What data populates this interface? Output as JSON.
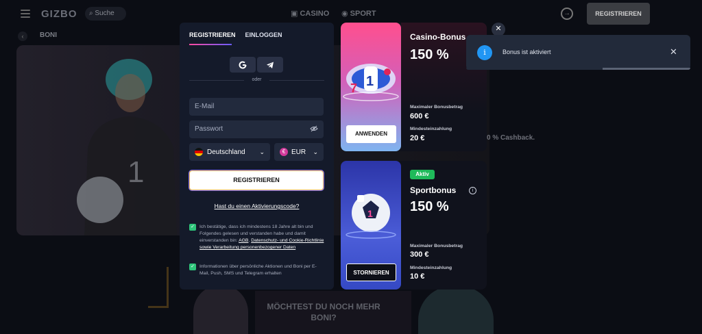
{
  "header": {
    "logo": "GIZBO",
    "search_placeholder": "Suche",
    "nav_casino": "CASINO",
    "nav_sport": "SPORT",
    "register_button": "REGISTRIEREN"
  },
  "breadcrumb": {
    "label": "BONI"
  },
  "background": {
    "cashback_text": "0 % Cashback.",
    "bottom_text": "MÖCHTEST DU NOCH MEHR BONI?"
  },
  "register_panel": {
    "tabs": [
      {
        "label": "REGISTRIEREN",
        "active": true
      },
      {
        "label": "EINLOGGEN",
        "active": false
      }
    ],
    "divider_text": "oder",
    "email_placeholder": "E-Mail",
    "password_placeholder": "Passwort",
    "country": "Deutschland",
    "currency": "EUR",
    "submit_label": "REGISTRIEREN",
    "activation_code_link": "Hast du einen Aktivierungscode?",
    "terms_text": "Ich bestätige, dass ich mindestens 18 Jahre alt bin und Folgendes gelesen und verstanden habe und damit einverstanden bin:",
    "terms_link_agb": "AGB",
    "terms_link_privacy": "Datenschutz- und Cookie-Richtlinie sowie Verarbeitung personenbezogener Daten",
    "newsletter_text": "Informationen über persönliche Aktionen und Boni per E-Mail, Push, SMS und Telegram erhalten",
    "terms_checked": true,
    "newsletter_checked": true
  },
  "bonus_cards": [
    {
      "title": "Casino-Bonus",
      "percent": "150 %",
      "max_label": "Maximaler Bonusbetrag",
      "max_value": "600 €",
      "min_label": "Mindesteinzahlung",
      "min_value": "20 €",
      "button": "ANWENDEN"
    },
    {
      "badge": "Aktiv",
      "title": "Sportbonus",
      "percent": "150 %",
      "max_label": "Maximaler Bonusbetrag",
      "max_value": "300 €",
      "min_label": "Mindesteinzahlung",
      "min_value": "10 €",
      "button": "STORNIEREN"
    }
  ],
  "toast": {
    "message": "Bonus ist aktiviert",
    "progress_remaining": 0.39,
    "accent_color": "#2196f3"
  },
  "colors": {
    "active_badge": "#1fba5a",
    "checkbox": "#2ec47a"
  }
}
